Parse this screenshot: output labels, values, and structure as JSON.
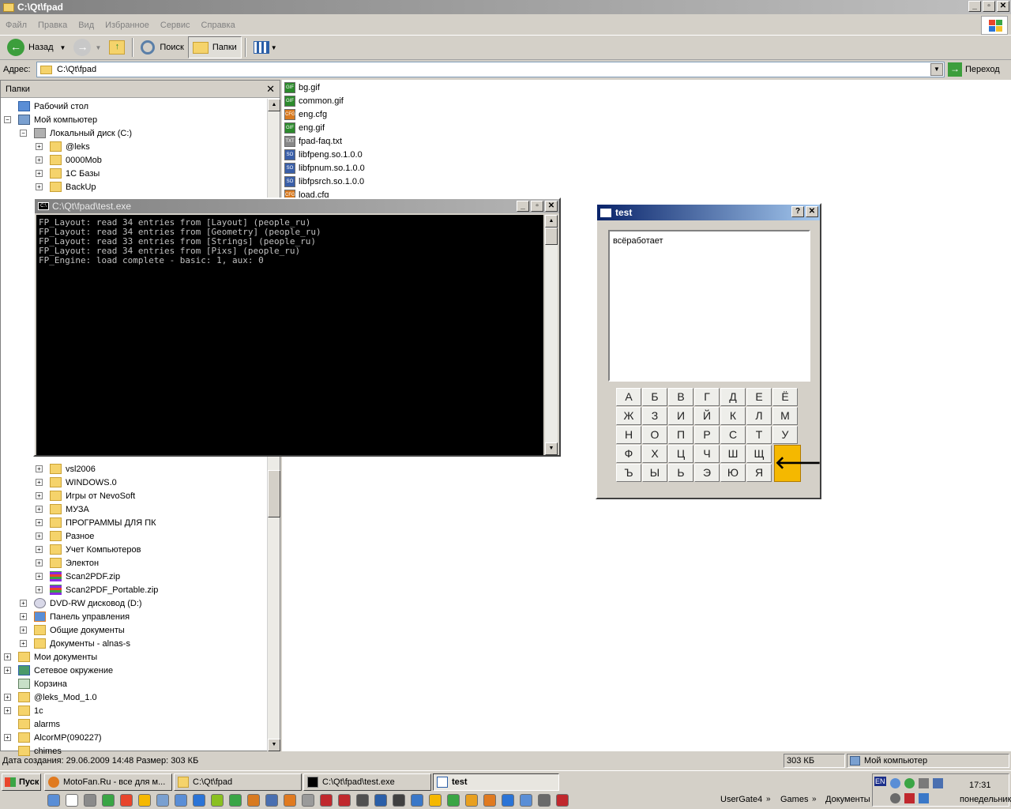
{
  "window": {
    "title": "C:\\Qt\\fpad",
    "btn_min": "_",
    "btn_max": "▫",
    "btn_close": "✕"
  },
  "menu": [
    "Файл",
    "Правка",
    "Вид",
    "Избранное",
    "Сервис",
    "Справка"
  ],
  "toolbar": {
    "back": "Назад",
    "search": "Поиск",
    "folders": "Папки"
  },
  "address": {
    "label": "Адрес:",
    "value": "C:\\Qt\\fpad",
    "go": "Переход"
  },
  "folders_pane": {
    "title": "Папки",
    "items": [
      {
        "label": "Рабочий стол",
        "exp": "",
        "kind": "desktop"
      },
      {
        "label": "Мой компьютер",
        "exp": "−",
        "kind": "computer"
      },
      {
        "label": "Локальный диск (C:)",
        "exp": "−",
        "kind": "disk"
      },
      {
        "label": "@leks",
        "exp": "+",
        "kind": "folder"
      },
      {
        "label": "0000Mob",
        "exp": "+",
        "kind": "folder"
      },
      {
        "label": "1С Базы",
        "exp": "+",
        "kind": "folder"
      },
      {
        "label": "BackUp",
        "exp": "+",
        "kind": "folder"
      },
      {
        "label": "vsl2006",
        "exp": "+",
        "kind": "folder"
      },
      {
        "label": "WINDOWS.0",
        "exp": "+",
        "kind": "folder"
      },
      {
        "label": "Игры от NevoSoft",
        "exp": "+",
        "kind": "folder"
      },
      {
        "label": "МУЗА",
        "exp": "+",
        "kind": "folder"
      },
      {
        "label": "ПРОГРАММЫ ДЛЯ ПК",
        "exp": "+",
        "kind": "folder"
      },
      {
        "label": "Разное",
        "exp": "+",
        "kind": "folder"
      },
      {
        "label": "Учет Компьютеров",
        "exp": "+",
        "kind": "folder"
      },
      {
        "label": "Электон",
        "exp": "+",
        "kind": "folder"
      },
      {
        "label": "Scan2PDF.zip",
        "exp": "+",
        "kind": "zip"
      },
      {
        "label": "Scan2PDF_Portable.zip",
        "exp": "+",
        "kind": "zip"
      },
      {
        "label": "DVD-RW дисковод (D:)",
        "exp": "+",
        "kind": "dvd"
      },
      {
        "label": "Панель управления",
        "exp": "+",
        "kind": "control"
      },
      {
        "label": "Общие документы",
        "exp": "+",
        "kind": "folder"
      },
      {
        "label": "Документы - alnas-s",
        "exp": "+",
        "kind": "folder"
      },
      {
        "label": "Мои документы",
        "exp": "+",
        "kind": "folder"
      },
      {
        "label": "Сетевое окружение",
        "exp": "+",
        "kind": "network"
      },
      {
        "label": "Корзина",
        "exp": "",
        "kind": "recycle"
      },
      {
        "label": "@leks_Mod_1.0",
        "exp": "+",
        "kind": "folder"
      },
      {
        "label": "1c",
        "exp": "+",
        "kind": "folder"
      },
      {
        "label": "alarms",
        "exp": "",
        "kind": "folder"
      },
      {
        "label": "AlcorMP(090227)",
        "exp": "+",
        "kind": "folder"
      },
      {
        "label": "chimes",
        "exp": "",
        "kind": "folder"
      }
    ]
  },
  "files": [
    {
      "name": "bg.gif",
      "type": "GIF"
    },
    {
      "name": "common.gif",
      "type": "GIF"
    },
    {
      "name": "eng.cfg",
      "type": "CFG"
    },
    {
      "name": "eng.gif",
      "type": "GIF"
    },
    {
      "name": "fpad-faq.txt",
      "type": "TXT"
    },
    {
      "name": "libfpeng.so.1.0.0",
      "type": "SO"
    },
    {
      "name": "libfpnum.so.1.0.0",
      "type": "SO"
    },
    {
      "name": "libfpsrch.so.1.0.0",
      "type": "SO"
    },
    {
      "name": "load.cfg",
      "type": "CFG"
    }
  ],
  "console": {
    "title": "C:\\Qt\\fpad\\test.exe",
    "icon_text": "C:\\",
    "lines": [
      "FP_Layout: read 34 entries from [Layout] (people_ru)",
      "FP_Layout: read 34 entries from [Geometry] (people_ru)",
      "FP_Layout: read 33 entries from [Strings] (people_ru)",
      "FP_Layout: read 34 entries from [Pixs] (people_ru)",
      "FP_Engine: load complete - basic: 1, aux: 0"
    ]
  },
  "test_window": {
    "title": "test",
    "help": "?",
    "close": "✕",
    "text": "всёработает",
    "keys": [
      [
        "А",
        "Б",
        "В",
        "Г",
        "Д",
        "Е",
        "Ё"
      ],
      [
        "Ж",
        "З",
        "И",
        "Й",
        "К",
        "Л",
        "М"
      ],
      [
        "Н",
        "О",
        "П",
        "Р",
        "С",
        "Т",
        "У"
      ],
      [
        "Ф",
        "Х",
        "Ц",
        "Ч",
        "Ш",
        "Щ"
      ],
      [
        "Ъ",
        "Ы",
        "Ь",
        "Э",
        "Ю",
        "Я"
      ]
    ],
    "backspace": "🡐"
  },
  "status": {
    "info": "Дата создания: 29.06.2009 14:48 Размер: 303 КБ",
    "size": "303 КБ",
    "location": "Мой компьютер"
  },
  "taskbar": {
    "start": "Пуск",
    "tasks": [
      {
        "label": "MotoFan.Ru - все для м...",
        "active": false
      },
      {
        "label": "C:\\Qt\\fpad",
        "active": false
      },
      {
        "label": "C:\\Qt\\fpad\\test.exe",
        "active": false
      },
      {
        "label": "test",
        "active": true
      }
    ],
    "toolbars": [
      "UserGate4",
      "Games",
      "Документы"
    ],
    "lang": "EN",
    "time": "17:31",
    "day": "понедельник"
  }
}
